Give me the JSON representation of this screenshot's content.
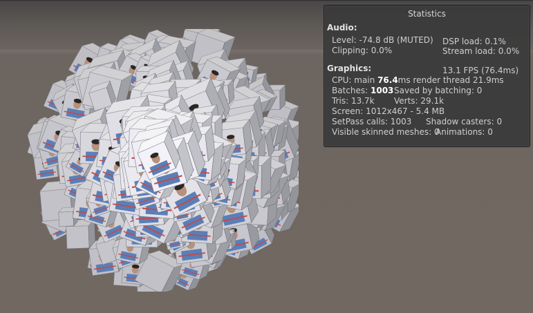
{
  "scene": {
    "background_sky": "#5e5a57",
    "background_ground": "#716961",
    "cube_count_visual": "many textured cubes"
  },
  "stats": {
    "title": "Statistics",
    "audio": {
      "heading": "Audio:",
      "level": "Level: -74.8 dB (MUTED)",
      "clipping": "Clipping: 0.0%",
      "dsp_load": "DSP load: 0.1%",
      "stream_load": "Stream load: 0.0%"
    },
    "graphics": {
      "heading": "Graphics:",
      "fps": "13.1 FPS (76.4ms)",
      "cpu_prefix": "CPU: main ",
      "cpu_main": "76.4",
      "cpu_suffix": "ms  render thread 21.9ms",
      "batches_prefix": "Batches: ",
      "batches": "1003",
      "saved_batching": "Saved by batching: 0",
      "tris": "Tris: 13.7k",
      "verts": "Verts: 29.1k",
      "screen": "Screen: 1012x467 - 5.4 MB",
      "setpass": "SetPass calls: 1003",
      "shadow_casters": "Shadow casters: 0",
      "visible_skinned": "Visible skinned meshes: 0",
      "animations": "Animations: 0"
    }
  }
}
